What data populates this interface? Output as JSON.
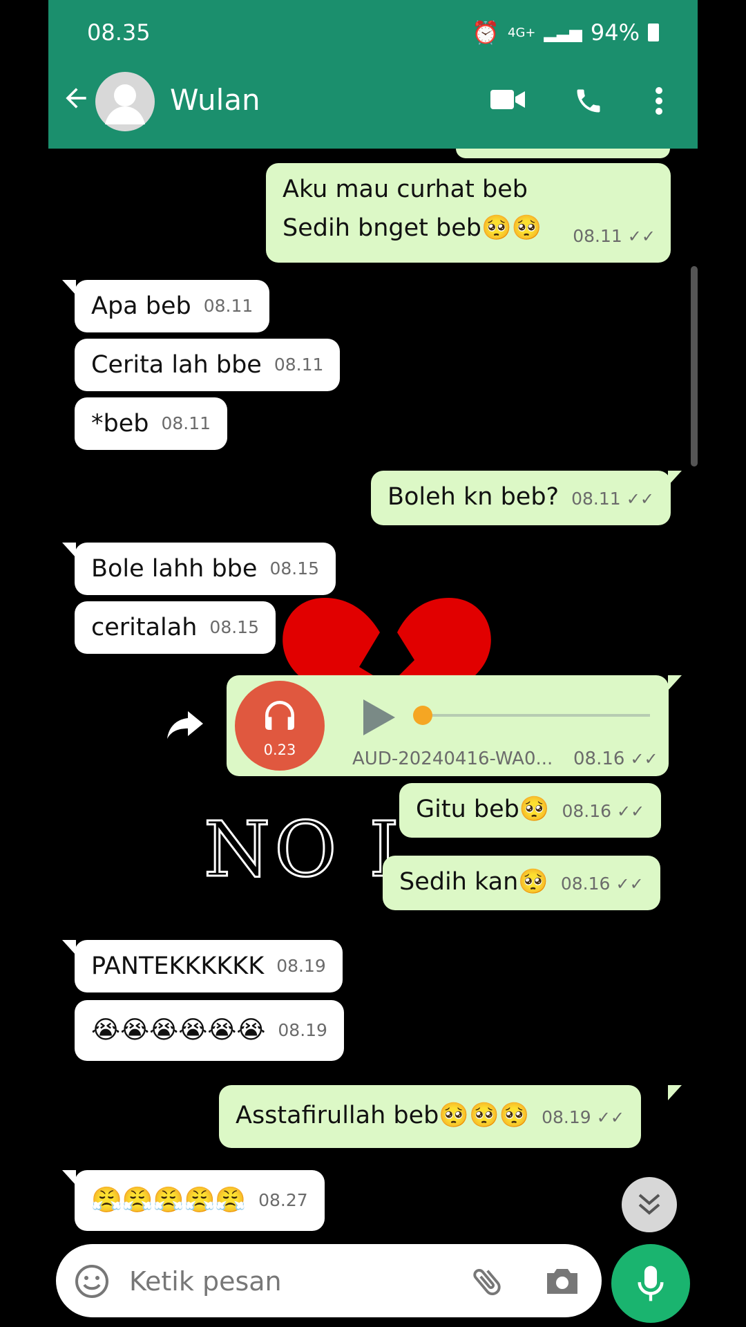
{
  "status": {
    "time": "08.35",
    "network": "4G+",
    "battery": "94%"
  },
  "header": {
    "contact_name": "Wulan"
  },
  "messages": [
    {
      "id": "m1",
      "dir": "out",
      "lines": [
        "Aku mau curhat beb",
        "Sedih bnget beb🥺🥺"
      ],
      "time": "08.11"
    },
    {
      "id": "m2",
      "dir": "in",
      "text": "Apa beb",
      "time": "08.11"
    },
    {
      "id": "m3",
      "dir": "in",
      "text": "Cerita lah bbe",
      "time": "08.11"
    },
    {
      "id": "m4",
      "dir": "in",
      "text": "*beb",
      "time": "08.11"
    },
    {
      "id": "m5",
      "dir": "out",
      "text": "Boleh kn beb?",
      "time": "08.11"
    },
    {
      "id": "m6",
      "dir": "in",
      "text": "Bole lahh bbe",
      "time": "08.15"
    },
    {
      "id": "m7",
      "dir": "in",
      "text": "ceritalah",
      "time": "08.15"
    },
    {
      "id": "m9",
      "dir": "out",
      "text": "Gitu beb🥺",
      "time": "08.16"
    },
    {
      "id": "m10",
      "dir": "out",
      "text": "Sedih kan🥺",
      "time": "08.16"
    },
    {
      "id": "m11",
      "dir": "in",
      "text": "PANTEKKKKKK",
      "time": "08.19"
    },
    {
      "id": "m12",
      "dir": "in",
      "text": "😭😭😭😭😭😭",
      "time": "08.19"
    },
    {
      "id": "m13",
      "dir": "out",
      "text": "Asstafirullah beb🥺🥺🥺",
      "time": "08.19"
    },
    {
      "id": "m14",
      "dir": "in",
      "text": "😤😤😤😤😤",
      "time": "08.27"
    }
  ],
  "audio_message": {
    "duration": "0.23",
    "filename": "AUD-20240416-WA0...",
    "time": "08.16",
    "progress": 0.0
  },
  "background_art": {
    "text": "NO L"
  },
  "composer": {
    "placeholder": "Ketik pesan"
  },
  "colors": {
    "header": "#1b8f6d",
    "outgoing": "#dcf8c6",
    "incoming": "#ffffff",
    "mic": "#1ab46f",
    "audio_badge": "#e0583f"
  }
}
